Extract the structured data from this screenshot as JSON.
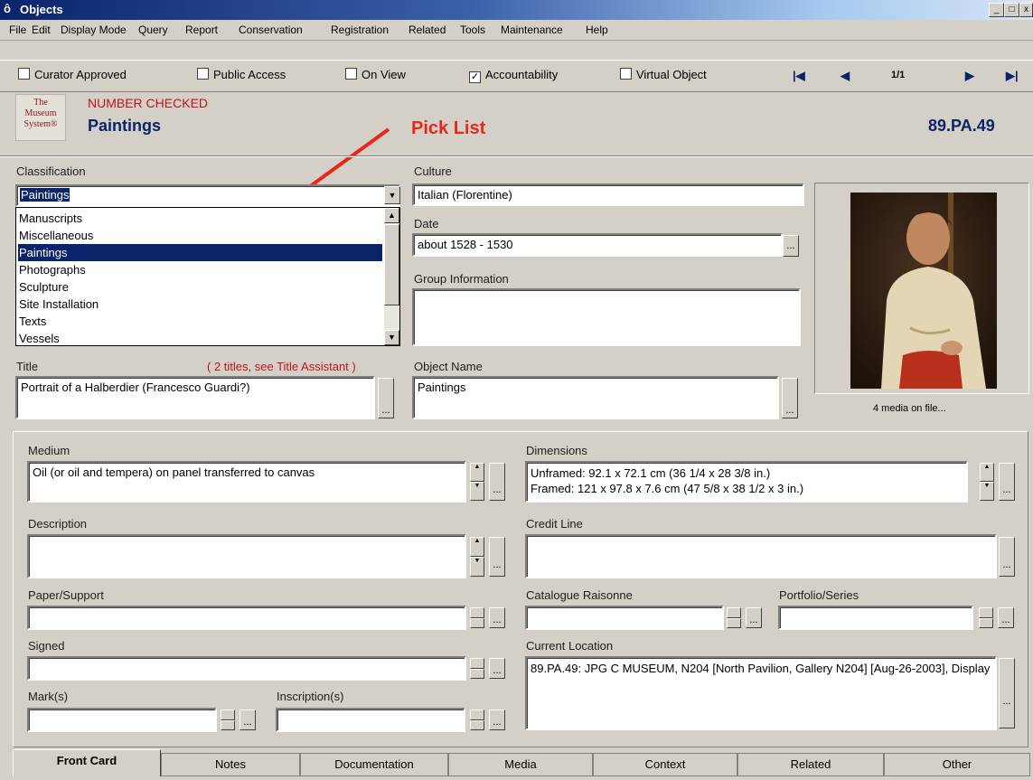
{
  "window": {
    "title": "Objects",
    "icon": "app-icon"
  },
  "menu": [
    "File",
    "Edit",
    "Display Mode",
    "Query",
    "Report",
    "Conservation",
    "Registration",
    "Related",
    "Tools",
    "Maintenance",
    "Help"
  ],
  "flags": [
    {
      "label": "Curator Approved",
      "checked": false
    },
    {
      "label": "Public Access",
      "checked": false
    },
    {
      "label": "On View",
      "checked": false
    },
    {
      "label": "Accountability",
      "checked": true
    },
    {
      "label": "Virtual Object",
      "checked": false
    }
  ],
  "navigator": {
    "record": "1/1"
  },
  "logo": {
    "line1": "The",
    "line2": "Museum",
    "line3": "System®"
  },
  "header": {
    "status": "NUMBER CHECKED",
    "classification": "Paintings",
    "object_number": "89.PA.49"
  },
  "annotation": {
    "text": "Pick List",
    "color": "#e8261c"
  },
  "classification": {
    "label": "Classification",
    "value": "Paintings",
    "options": [
      "Manuscripts",
      "Miscellaneous",
      "Paintings",
      "Photographs",
      "Sculpture",
      "Site Installation",
      "Texts",
      "Vessels"
    ],
    "selected_index": 2
  },
  "culture": {
    "label": "Culture",
    "value": "Italian (Florentine)"
  },
  "date": {
    "label": "Date",
    "value": "about 1528 - 1530"
  },
  "group_info": {
    "label": "Group Information",
    "value": ""
  },
  "title_field": {
    "label": "Title",
    "note": "( 2 titles, see Title Assistant )",
    "value": "Portrait of a Halberdier (Francesco Guardi?)"
  },
  "object_name": {
    "label": "Object Name",
    "value": "Paintings"
  },
  "media": {
    "caption": "4 media on file..."
  },
  "medium": {
    "label": "Medium",
    "value": "Oil (or oil and tempera) on panel transferred to canvas"
  },
  "dimensions": {
    "label": "Dimensions",
    "line1": "Unframed: 92.1 x 72.1 cm (36 1/4 x 28 3/8 in.)",
    "line2": "Framed: 121 x 97.8 x 7.6 cm (47 5/8 x 38 1/2 x 3 in.)"
  },
  "description": {
    "label": "Description",
    "value": ""
  },
  "credit_line": {
    "label": "Credit Line",
    "value": ""
  },
  "paper_support": {
    "label": "Paper/Support",
    "value": ""
  },
  "catalogue_raisonne": {
    "label": "Catalogue Raisonne",
    "value": ""
  },
  "portfolio_series": {
    "label": "Portfolio/Series",
    "value": ""
  },
  "signed": {
    "label": "Signed",
    "value": ""
  },
  "current_location": {
    "label": "Current Location",
    "value": "89.PA.49: JPG C MUSEUM, N204 [North Pavilion, Gallery N204] [Aug-26-2003], Display"
  },
  "marks": {
    "label": "Mark(s)",
    "value": ""
  },
  "inscriptions": {
    "label": "Inscription(s)",
    "value": ""
  },
  "tabs": [
    "Front Card",
    "Notes",
    "Documentation",
    "Media",
    "Context",
    "Related",
    "Other"
  ],
  "active_tab": 0
}
